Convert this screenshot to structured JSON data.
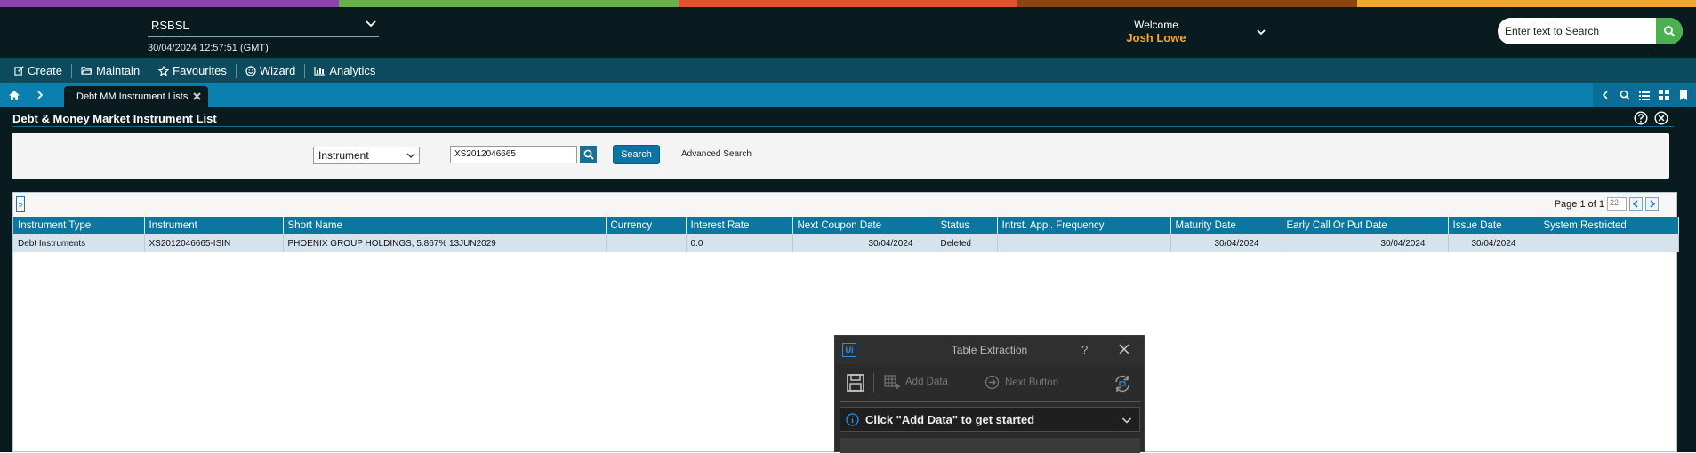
{
  "colors": {
    "stripe": [
      "#8e44ad",
      "#6ab04c",
      "#e0532e",
      "#8b4513",
      "#f0a830"
    ],
    "accent": "#0b76a0",
    "username": "#f5a623",
    "search_button": "#4caf50"
  },
  "header": {
    "company": "RSBSL",
    "datetime": "30/04/2024 12:57:51 (GMT)",
    "welcome": "Welcome",
    "username": "Josh Lowe",
    "search_placeholder": "Enter text to Search"
  },
  "menu": {
    "items": [
      {
        "label": "Create",
        "icon": "edit-icon"
      },
      {
        "label": "Maintain",
        "icon": "folder-open-icon"
      },
      {
        "label": "Favourites",
        "icon": "star-icon"
      },
      {
        "label": "Wizard",
        "icon": "smile-icon"
      },
      {
        "label": "Analytics",
        "icon": "bar-chart-icon"
      }
    ]
  },
  "tabs": {
    "active_tab": "Debt MM Instrument Lists"
  },
  "page": {
    "title": "Debt & Money Market Instrument List"
  },
  "search": {
    "type_selected": "Instrument",
    "value": "XS2012046665",
    "button_label": "Search",
    "advanced_label": "Advanced Search"
  },
  "grid": {
    "expand_label": "»",
    "pager_text": "Page 1 of 1",
    "page_size": "22",
    "columns": [
      "Instrument Type",
      "Instrument",
      "Short Name",
      "Currency",
      "Interest Rate",
      "Next Coupon Date",
      "Status",
      "Intrst. Appl. Frequency",
      "Maturity Date",
      "Early Call Or Put Date",
      "Issue Date",
      "System Restricted"
    ],
    "rows": [
      [
        "Debt Instruments",
        "XS2012046665-ISIN",
        "PHOENIX GROUP HOLDINGS, 5.867% 13JUN2029",
        "",
        "0.0",
        "30/04/2024",
        "Deleted",
        "",
        "30/04/2024",
        "30/04/2024",
        "30/04/2024",
        ""
      ]
    ]
  },
  "dialog": {
    "logo": "Ui",
    "title": "Table Extraction",
    "help": "?",
    "add_data": "Add Data",
    "next_button": "Next Button",
    "banner": "Click \"Add Data\" to get started"
  }
}
